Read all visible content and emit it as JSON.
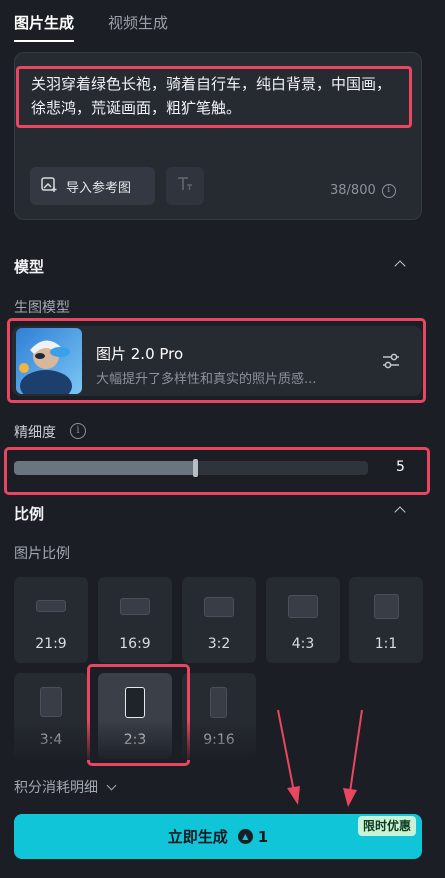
{
  "tabs": [
    {
      "label": "图片生成",
      "active": true
    },
    {
      "label": "视频生成",
      "active": false
    }
  ],
  "prompt": {
    "text": "关羽穿着绿色长袍，骑着自行车，纯白背景，中国画，徐悲鸿，荒诞画面，粗犷笔触。",
    "import_ref_label": "导入参考图",
    "char_count": "38/800"
  },
  "model_section": {
    "title": "模型",
    "sub_label": "生图模型",
    "model_name": "图片 2.0 Pro",
    "model_desc": "大幅提升了多样性和真实的照片质感..."
  },
  "detail": {
    "label": "精细度",
    "value": "5",
    "fill_fraction": 0.5
  },
  "ratio_section": {
    "title": "比例",
    "sub_label": "图片比例",
    "options": [
      "21:9",
      "16:9",
      "3:2",
      "4:3",
      "1:1",
      "3:4",
      "2:3",
      "9:16"
    ],
    "selected": "2:3"
  },
  "points_detail_label": "积分消耗明细",
  "generate": {
    "label": "立即生成",
    "cost": "1",
    "promo": "限时优惠"
  },
  "colors": {
    "accent": "#10c5d8",
    "highlight_outline": "#e8475f",
    "background": "#1b1e24"
  }
}
